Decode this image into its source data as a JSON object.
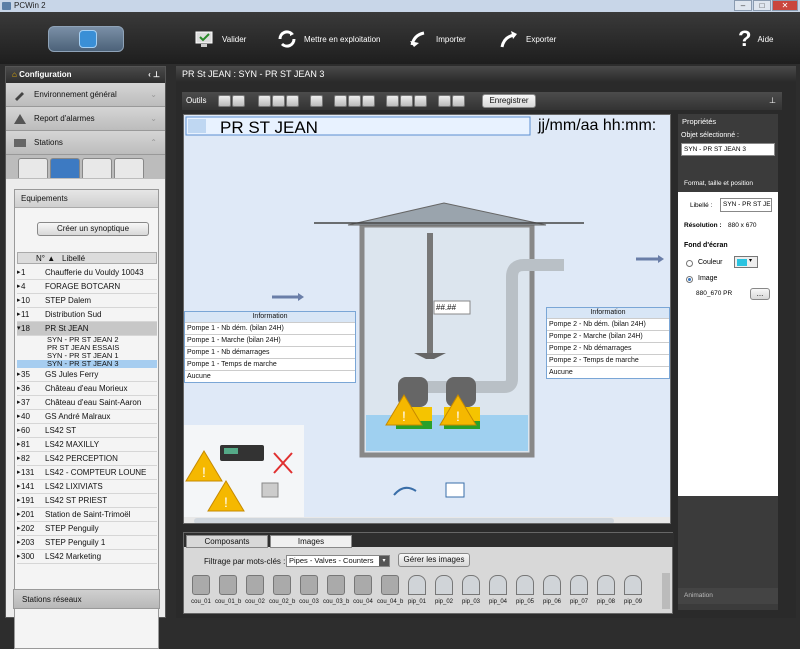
{
  "window": {
    "title": "PCWin 2",
    "title_blurred": "[...] - [...]"
  },
  "toolbar": {
    "validate": "Valider",
    "deploy": "Mettre en exploitation",
    "import": "Importer",
    "export": "Exporter",
    "help": "Aide"
  },
  "left": {
    "header": "Configuration",
    "sections": [
      "Environnement général",
      "Report d'alarmes",
      "Stations"
    ],
    "equip_header": "Equipements",
    "create_btn": "Créer un synoptique",
    "col_no": "N° ▲",
    "col_label": "Libellé",
    "rows_before": [
      {
        "n": "1",
        "l": "Chaufferie du Vouldy  10043"
      },
      {
        "n": "4",
        "l": "FORAGE BOTCARN"
      },
      {
        "n": "10",
        "l": "STEP Dalem"
      },
      {
        "n": "11",
        "l": "Distribution Sud"
      }
    ],
    "selected": {
      "n": "18",
      "l": "PR St JEAN"
    },
    "sub_items": [
      "SYN - PR ST JEAN 2",
      "PR ST JEAN ESSAIS",
      "SYN - PR ST JEAN 1",
      "SYN - PR ST JEAN 3"
    ],
    "rows_after": [
      {
        "n": "35",
        "l": "GS Jules Ferry"
      },
      {
        "n": "36",
        "l": "Château d'eau Morieux"
      },
      {
        "n": "37",
        "l": "Château d'eau Saint-Aaron"
      },
      {
        "n": "40",
        "l": "GS André Malraux"
      },
      {
        "n": "60",
        "l": "LS42 ST"
      },
      {
        "n": "81",
        "l": "LS42 MAXILLY"
      },
      {
        "n": "82",
        "l": "LS42 PERCEPTION"
      },
      {
        "n": "131",
        "l": "LS42 - COMPTEUR LOUNE"
      },
      {
        "n": "141",
        "l": "LS42 LIXIVIATS"
      },
      {
        "n": "191",
        "l": "LS42 ST PRIEST"
      },
      {
        "n": "201",
        "l": "Station de Saint-Trimoël"
      },
      {
        "n": "202",
        "l": "STEP Penguily"
      },
      {
        "n": "203",
        "l": "STEP Penguily 1"
      },
      {
        "n": "300",
        "l": "LS42 Marketing"
      }
    ],
    "network": "Stations réseaux"
  },
  "main": {
    "title": "PR St JEAN : SYN - PR ST JEAN 3",
    "tools_label": "Outils",
    "save_btn": "Enregistrer",
    "canvas": {
      "station_title": "PR ST JEAN",
      "datetime": "jj/mm/aa hh:mm:",
      "value_placeholder": "##.##",
      "info_header": "Information",
      "info_left": [
        "Pompe 1 - Nb dém. (bilan 24H)",
        "Pompe 1 - Marche (bilan 24H)",
        "Pompe 1 - Nb démarrages",
        "Pompe 1 - Temps de marche",
        "Aucune"
      ],
      "info_right": [
        "Pompe 2 - Nb dém. (bilan 24H)",
        "Pompe 2 - Marche (bilan 24H)",
        "Pompe 2 - Nb démarrages",
        "Pompe 2 - Temps de marche",
        "Aucune"
      ]
    },
    "bottom": {
      "tab_components": "Composants",
      "tab_images": "Images",
      "filter_label": "Filtrage par mots-clés :",
      "filter_value": "Pipes - Valves - Counters",
      "manage_btn": "Gérer les images",
      "items": [
        "cou_01",
        "cou_01_b",
        "cou_02",
        "cou_02_b",
        "cou_03",
        "cou_03_b",
        "cou_04",
        "cou_04_b",
        "pip_01",
        "pip_02",
        "pip_03",
        "pip_04",
        "pip_05",
        "pip_06",
        "pip_07",
        "pip_08",
        "pip_09"
      ]
    }
  },
  "props": {
    "header": "Propriétés",
    "selected_label": "Objet sélectionné :",
    "selected_value": "SYN - PR ST JEAN 3",
    "format_header": "Format, taille et position",
    "libelle_label": "Libellé :",
    "libelle_value": "SYN - PR ST JE",
    "resolution_label": "Résolution :",
    "resolution_value": "880 x 670",
    "bg_header": "Fond d'écran",
    "opt_color": "Couleur",
    "opt_image": "Image",
    "image_value": "880_670 PR",
    "image_btn": "...",
    "animation": "Animation"
  },
  "colors": {
    "accent": "#3d7ac2",
    "selection": "#a6cdf0",
    "canvas_bg": "#dfe9f7",
    "alarm": "#f5b800"
  }
}
